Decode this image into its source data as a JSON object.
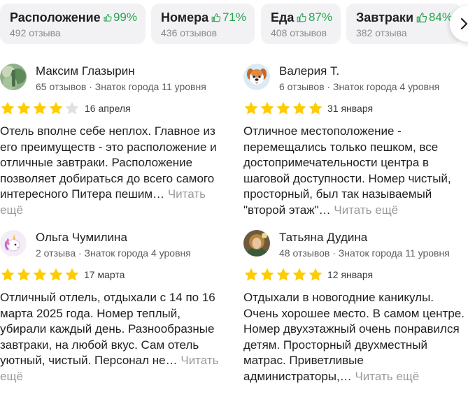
{
  "categories": [
    {
      "title": "Расположение",
      "percent": "99%",
      "count": "492 отзыва"
    },
    {
      "title": "Номера",
      "percent": "71%",
      "count": "436 отзывов"
    },
    {
      "title": "Еда",
      "percent": "87%",
      "count": "408 отзывов"
    },
    {
      "title": "Завтраки",
      "percent": "84%",
      "count": "382 отзыва"
    }
  ],
  "reviews": [
    {
      "name": "Максим Глазырин",
      "meta": "65 отзывов · Знаток города 11 уровня",
      "rating": 4,
      "date": "16 апреля",
      "text": "Отель вполне себе неплох. Главное из его преимуществ - это расположение и отличные завтраки. Расположение позволяет добираться до всего самого интересного Питера пешим…",
      "more": "Читать ещё"
    },
    {
      "name": "Валерия Т.",
      "meta": "6 отзывов · Знаток города 4 уровня",
      "rating": 5,
      "date": "31 января",
      "text": "Отличное местоположение - перемещались только пешком, все достопримечательности центра в шаговой доступности. Номер чистый, просторный, был так называемый \"второй этаж\"…",
      "more": "Читать ещё"
    },
    {
      "name": "Ольга Чумилина",
      "meta": "2 отзыва · Знаток города 4 уровня",
      "rating": 5,
      "date": "17 марта",
      "text": "Отличный отлель, отдыхали с 14 по 16 марта 2025 года. Номер теплый, убирали каждый день. Разнообразные завтраки, на любой вкус. Сам отель уютный, чистый. Персонал не…",
      "more": "Читать ещё"
    },
    {
      "name": "Татьяна Дудина",
      "meta": "48 отзывов · Знаток города 11 уровня",
      "rating": 5,
      "date": "12 января",
      "text": "Отдыхали в новогодние каникулы. Очень хорошее место. В самом центре. Номер двухэтажный очень понравился детям. Просторный двухместный матрас. Приветливые администраторы,…",
      "more": "Читать ещё"
    }
  ],
  "colors": {
    "star_filled": "#fc0",
    "star_empty": "#e0e0e0",
    "positive": "#27a44e"
  },
  "icons": [
    "thumb-up-icon",
    "chevron-right-icon",
    "star-icon"
  ]
}
